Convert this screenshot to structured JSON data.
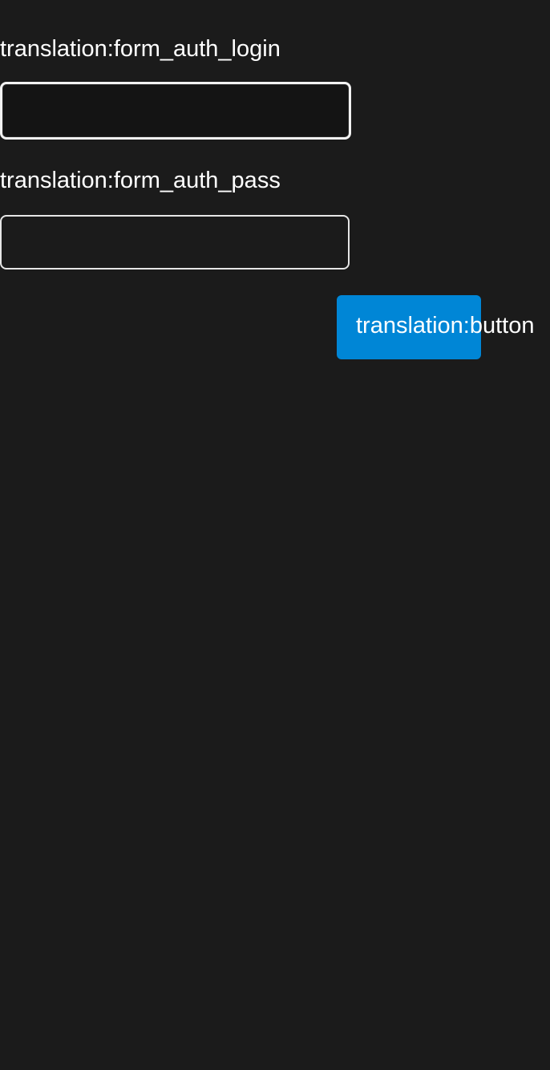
{
  "form": {
    "login_label": "translation:form_auth_login",
    "login_value": "",
    "pass_label": "translation:form_auth_pass",
    "pass_value": "",
    "submit_label": "translation:button"
  },
  "colors": {
    "background": "#1b1b1b",
    "text": "#ffffff",
    "input_border": "#e6e6e6",
    "button_bg": "#0086d6"
  }
}
